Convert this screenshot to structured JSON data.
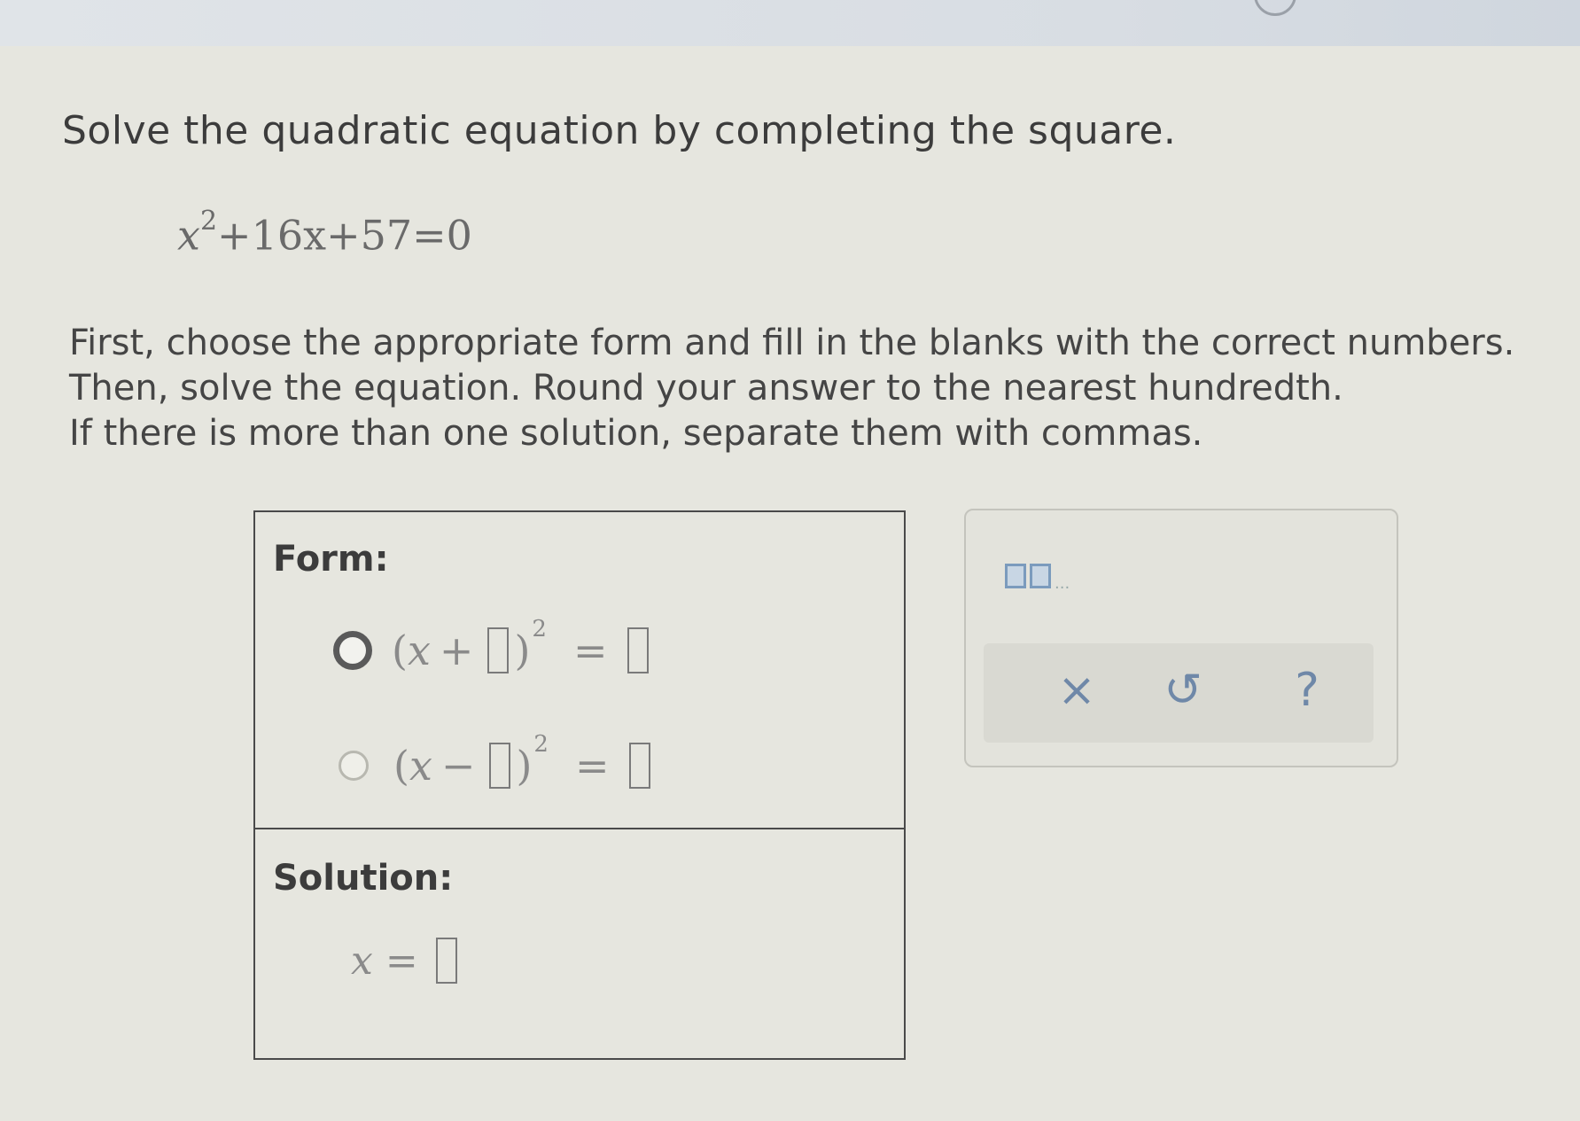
{
  "question": {
    "prompt": "Solve the quadratic equation by completing the square.",
    "equation": {
      "var": "x",
      "exponent": "2",
      "rest": "+16x+57=0"
    },
    "instructions": [
      "First, choose the appropriate form and fill in the blanks with the correct numbers.",
      "Then, solve the equation. Round your answer to the nearest hundredth.",
      "If there is more than one solution, separate them with commas."
    ]
  },
  "answer": {
    "form_label": "Form:",
    "options": [
      {
        "open": "(",
        "var": "x",
        "sign": "+",
        "close": ")",
        "exponent": "2",
        "equals": "=",
        "selected": true
      },
      {
        "open": "(",
        "var": "x",
        "sign": "−",
        "close": ")",
        "exponent": "2",
        "equals": "=",
        "selected": false
      }
    ],
    "solution_label": "Solution:",
    "solution": {
      "var": "x",
      "equals": "=",
      "value": ""
    }
  },
  "toolbar": {
    "template_icon": "blank-comma-blank-icon",
    "template_dots": "...",
    "clear_symbol": "×",
    "undo_symbol": "↺",
    "help_symbol": "?"
  }
}
